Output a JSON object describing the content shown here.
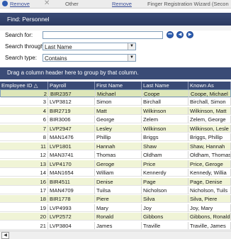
{
  "topbar": {
    "remove_link_1": "Remove",
    "other_label": "Other",
    "remove_link_2": "Remove",
    "wizard_label": "Finger Registration Wizard (Secon"
  },
  "panel": {
    "title": "Find: Personnel"
  },
  "search": {
    "search_for_label": "Search for:",
    "search_for_value": "",
    "search_through_label": "Search through:",
    "search_through_value": "Last Name",
    "search_type_label": "Search type:",
    "search_type_value": "Contains",
    "dropdown_glyph": "▼"
  },
  "nav": {
    "first": "⏮",
    "prev": "◀",
    "next": "▶"
  },
  "groupbar": {
    "text": "Drag a column header here to group by that column."
  },
  "grid": {
    "columns": [
      "Employee ID △",
      "Payroll",
      "First Name",
      "Last Name",
      "Known As"
    ],
    "rows": [
      [
        "2",
        "BIR2357",
        "Michael",
        "Coope",
        "Coope, Michael"
      ],
      [
        "3",
        "LVP3812",
        "Simon",
        "Birchall",
        "Birchall, Simon"
      ],
      [
        "4",
        "BIR2719",
        "Matt",
        "Wilkinson",
        "Wilkinson, Matt"
      ],
      [
        "6",
        "BIR3006",
        "George",
        "Zelem",
        "Zelem, George"
      ],
      [
        "7",
        "LVP2947",
        "Lesley",
        "Wilkinson",
        "Wilkinson, Lesle"
      ],
      [
        "8",
        "MAN1476",
        "Phillip",
        "Briggs",
        "Briggs, Phillip"
      ],
      [
        "11",
        "LVP1801",
        "Hannah",
        "Shaw",
        "Shaw, Hannah"
      ],
      [
        "12",
        "MAN3741",
        "Thomas",
        "Oldham",
        "Oldham, Thomas"
      ],
      [
        "13",
        "LVP4170",
        "Geroge",
        "Price",
        "Price, Geroge"
      ],
      [
        "14",
        "MAN1654",
        "William",
        "Kennerdy",
        "Kennedy, Willia"
      ],
      [
        "16",
        "BIR4511",
        "Denise",
        "Page",
        "Page, Denise"
      ],
      [
        "17",
        "MAN4709",
        "Tuilsa",
        "Nicholson",
        "Nicholson, Tuils"
      ],
      [
        "18",
        "BIR1778",
        "Piere",
        "Silva",
        "Silva, Piere"
      ],
      [
        "19",
        "LVP4993",
        "Mary",
        "Joy",
        "Joy, Mary"
      ],
      [
        "20",
        "LVP2572",
        "Ronald",
        "Gibbons",
        "Gibbons, Ronald"
      ],
      [
        "21",
        "LVP3804",
        "James",
        "Traville",
        "Traville, James"
      ]
    ]
  },
  "scrollbar": {
    "left_arrow": "◀"
  }
}
